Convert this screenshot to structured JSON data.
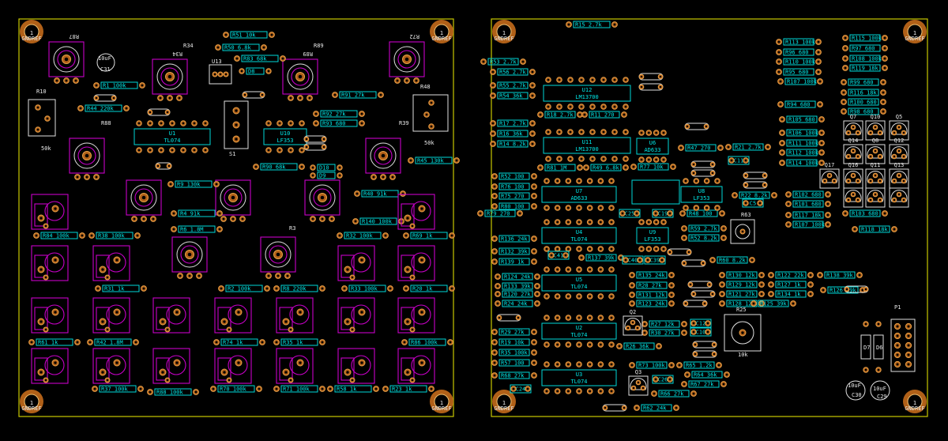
{
  "mount_hole": {
    "number": "1",
    "net": "GNDREF"
  },
  "left_board": {
    "pots": [
      "R87",
      "R34",
      "R89",
      "R72",
      "R88",
      "R39",
      "R3"
    ],
    "pot_labels_lower": [
      "50k",
      "50k"
    ],
    "trimmers": [
      "R10",
      "R48"
    ],
    "resistors": [
      "R51 10k",
      "R50 6.8k",
      "R83 68k",
      "R1 100k",
      "R44 220k",
      "R91 27k",
      "R92 27k",
      "R93 680",
      "R90 68k",
      "R9 130k",
      "R40 91k",
      "R45 130k",
      "R4 91k",
      "R6 1.8M",
      "R140 100k",
      "R84 100k",
      "R38 100k",
      "R32 100k",
      "R69 1k",
      "R31 1k",
      "R2 100k",
      "R8 220k",
      "R33 100k",
      "R20 1k",
      "R61 1k",
      "R42 1.8M",
      "R74 1k",
      "R35 1k",
      "R86 100k",
      "R37 100k",
      "R88 100k",
      "R70 100k",
      "R71 100k",
      "R58 1k",
      "R23 1k"
    ],
    "ics": [
      "TL074",
      "U1",
      "U10",
      "LF353",
      "U13"
    ],
    "switch": "S1",
    "caps": [
      "10uF",
      "C31"
    ],
    "diodes": [
      "D8",
      "D10",
      "D9"
    ]
  },
  "right_board": {
    "top_res": "R15 2.7k",
    "resistors_a": [
      "R53 2.7k",
      "R56 2.7k",
      "R55 2.7k",
      "R54 36k",
      "R18 2.7k",
      "R11 270",
      "R17 2.7k",
      "R16 36k",
      "R14 8.2k",
      "R81 1M",
      "R49 6.8k",
      "R77 10k",
      "R52 100",
      "R76 100",
      "R75 270",
      "R80 100",
      "R79 270",
      "R136 24k",
      "R132 39k",
      "R139 1k",
      "R137 39k",
      "R124 24k",
      "R133 39k",
      "R120 27k",
      "R24 24k",
      "R29 27k",
      "R19 10k",
      "R35 100k",
      "R57 100",
      "R68 27k"
    ],
    "resistors_b": [
      "R47 270",
      "R21 2.7k",
      "R22 8.2k",
      "R48 100",
      "R59 2.7k",
      "R52 8.2k",
      "R60 8.2k",
      "R135 24k",
      "R28 27k",
      "R131 12k",
      "R123 24k",
      "R130 12k",
      "R129 12k",
      "R121 27k",
      "R128 12k",
      "R122 22k",
      "R127 1k",
      "R134 1k",
      "R125 39k",
      "R138 39k",
      "R126 39k",
      "R27 12k",
      "R30 27k",
      "R26 36k",
      "R73 100k",
      "R65 1.2k",
      "R64 36k",
      "R67 27k",
      "R66 27k",
      "R62 24k"
    ],
    "resistors_c": [
      "R113 100k",
      "R96 680",
      "R110 100k",
      "R95 680",
      "R107 100k",
      "R94 680",
      "R105 680",
      "R106 100k",
      "R111 100k",
      "R112 100k",
      "R114 100k",
      "R115 100k",
      "R97 680",
      "R108 100k",
      "R119 18k",
      "R99 680",
      "R116 18k",
      "R100 680",
      "R98 680",
      "R102 680",
      "R101 680",
      "R117 18k",
      "R107 100k",
      "R103 680",
      "R118 18k"
    ],
    "ics": [
      {
        "ref": "U12",
        "val": "LM13700"
      },
      {
        "ref": "U11",
        "val": "LM13700"
      },
      {
        "ref": "U6",
        "val": "AD633"
      },
      {
        "ref": "U7",
        "val": "AD633"
      },
      {
        "ref": "U8",
        "val": "LF353"
      },
      {
        "ref": "U4",
        "val": "TL074"
      },
      {
        "ref": "U9",
        "val": "LF353"
      },
      {
        "ref": "U5",
        "val": "TL074"
      },
      {
        "ref": "U2",
        "val": "TL074"
      },
      {
        "ref": "U3",
        "val": "TL074"
      }
    ],
    "transistors": [
      "Q7",
      "Q10",
      "Q5",
      "Q14",
      "Q8",
      "Q12",
      "Q17",
      "Q16",
      "Q11",
      "Q13",
      "Q2",
      "Q3"
    ],
    "trimmers": [
      "R63",
      "R25"
    ],
    "trimmer_value": "10k",
    "connector": "P1",
    "diodes": [
      "D7",
      "D6"
    ],
    "caps": [
      "C11",
      "C5",
      "C25",
      "C19",
      "C41",
      "C40",
      "C39",
      "C12",
      "C10",
      "C26",
      "C24",
      "10uF",
      "C30",
      "C29"
    ]
  }
}
